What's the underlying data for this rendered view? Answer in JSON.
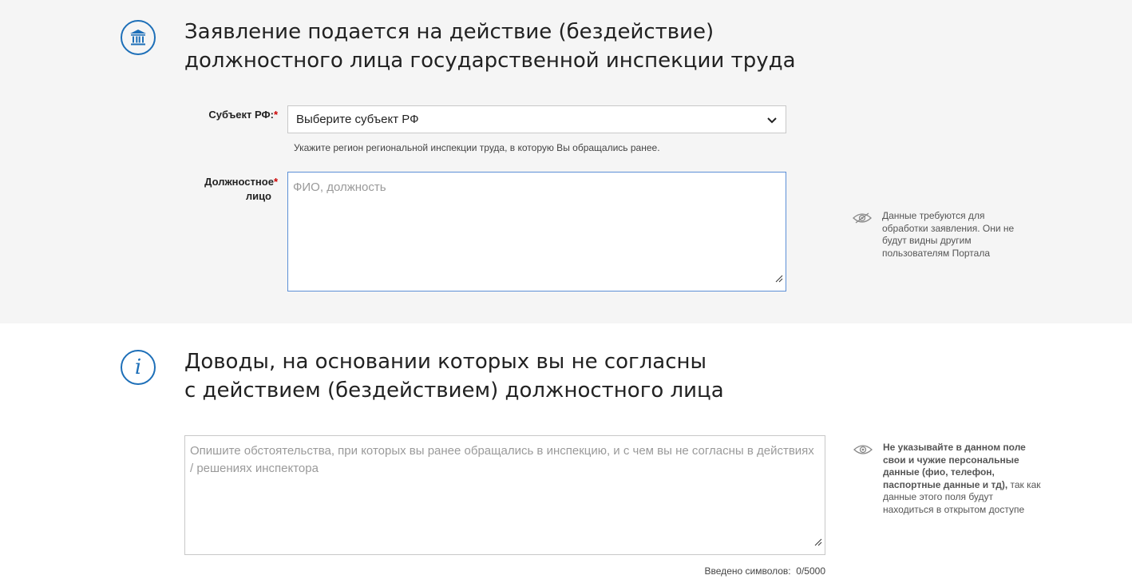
{
  "section1": {
    "icon": "institution-icon",
    "title_line1": "Заявление подается на действие (бездействие)",
    "title_line2": "должностного лица государственной инспекции труда",
    "subject": {
      "label": "Субъект РФ:",
      "required_mark": "*",
      "selected": "Выберите субъект РФ",
      "hint": "Укажите регион региональной инспекции труда, в которую Вы обращались ранее."
    },
    "official": {
      "label_line1": "Должностное",
      "label_line2": "лицо",
      "required_mark": "*",
      "placeholder": "ФИО, должность"
    },
    "privacy_note": "Данные требуются для обработки заявления. Они не будут видны другим пользователям Портала"
  },
  "section2": {
    "icon": "info-icon",
    "title_line1": "Доводы, на основании которых вы не согласны",
    "title_line2": "с действием (бездействием) должностного лица",
    "arguments": {
      "placeholder": "Опишите обстоятельства, при которых вы ранее обращались в инспекцию, и с чем вы не согласны в действиях / решениях инспектора",
      "counter_label": "Введено символов:",
      "counter_value": "0/5000"
    },
    "warning_bold": "Не указывайте в данном поле свои и чужие персональные данные (фио, телефон, паспортные данные и тд),",
    "warning_rest": "так как данные этого поля будут находиться в открытом доступе"
  },
  "colors": {
    "accent": "#1d6fb8",
    "required": "#cc0000",
    "gray_bg": "#f5f5f5"
  }
}
